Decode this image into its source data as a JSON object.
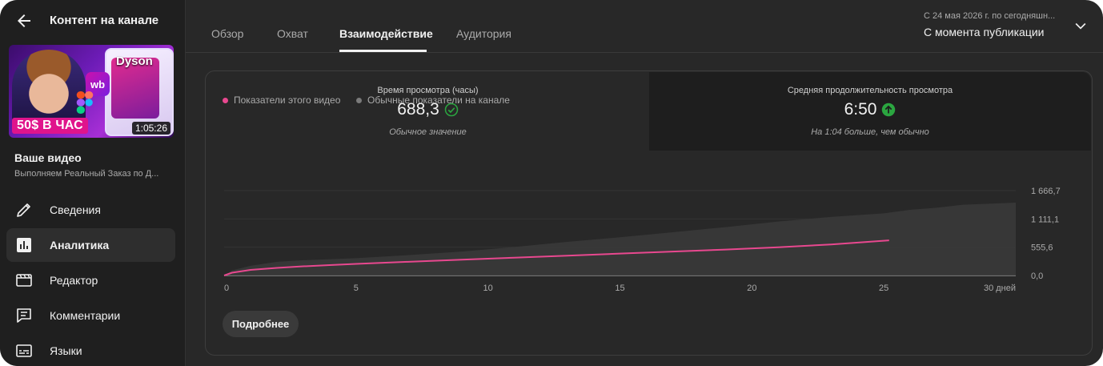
{
  "sidebar": {
    "title": "Контент на канале",
    "thumbnail": {
      "brand": "Dyson",
      "wb_logo": "wb",
      "badge": "50$ В ЧАС",
      "duration": "1:05:26"
    },
    "video_heading": "Ваше видео",
    "video_title": "Выполняем Реальный Заказ по Д...",
    "nav": [
      {
        "label": "Сведения",
        "icon": "pencil-icon"
      },
      {
        "label": "Аналитика",
        "icon": "analytics-icon"
      },
      {
        "label": "Редактор",
        "icon": "editor-icon"
      },
      {
        "label": "Комментарии",
        "icon": "comments-icon"
      },
      {
        "label": "Языки",
        "icon": "subtitles-icon"
      }
    ],
    "active_nav": "Аналитика"
  },
  "tabs": [
    "Обзор",
    "Охват",
    "Взаимодействие",
    "Аудитория"
  ],
  "active_tab": "Взаимодействие",
  "period": {
    "range_text": "С 24 мая 2026 г. по сегодняшн...",
    "label": "С момента публикации"
  },
  "metrics": [
    {
      "label": "Время просмотра (часы)",
      "value": "688,3",
      "note": "Обычное значение",
      "status_icon": "check-circle-icon",
      "status_color": "#2ba640"
    },
    {
      "label": "Средняя продолжительность просмотра",
      "value": "6:50",
      "note": "На 1:04 больше, чем обычно",
      "status_icon": "arrow-up-circle-icon",
      "status_color": "#2ba640"
    }
  ],
  "legend": {
    "this_video": "Показатели этого видео",
    "typical": "Обычные показатели на канале"
  },
  "colors": {
    "this_video": "#e8488f",
    "typical": "#7a7a7a",
    "typical_band": "#3a3a3a"
  },
  "chart_data": {
    "type": "line",
    "x_tick_labels": [
      "0",
      "5",
      "10",
      "15",
      "20",
      "25",
      "30 дней"
    ],
    "x_ticks": [
      0,
      5,
      10,
      15,
      20,
      25,
      30
    ],
    "y_tick_labels": [
      "1 666,7",
      "1 111,1",
      "555,6",
      "0,0"
    ],
    "y_ticks": [
      1666.7,
      1111.1,
      555.6,
      0
    ],
    "xlim": [
      0,
      30
    ],
    "ylim": [
      0,
      1666.7
    ],
    "series": [
      {
        "name": "Показатели этого видео",
        "x": [
          0,
          0.3,
          1,
          2,
          3,
          4,
          5,
          7,
          9,
          11,
          13,
          15,
          17,
          19,
          21,
          23,
          25.2
        ],
        "y": [
          0,
          55,
          110,
          150,
          180,
          205,
          228,
          270,
          310,
          350,
          390,
          430,
          470,
          510,
          555,
          610,
          690
        ]
      },
      {
        "name": "Обычные показатели на канале",
        "x": [
          0,
          0.3,
          1,
          2,
          3,
          5,
          7,
          9,
          11,
          13,
          15,
          17,
          19,
          21,
          23,
          25,
          26,
          27,
          28,
          29,
          30
        ],
        "y": [
          0,
          100,
          190,
          270,
          300,
          340,
          400,
          470,
          560,
          660,
          750,
          850,
          950,
          1060,
          1150,
          1220,
          1290,
          1330,
          1390,
          1410,
          1430
        ]
      }
    ],
    "grid": true,
    "legend": "top-left"
  },
  "more_button": "Подробнее"
}
